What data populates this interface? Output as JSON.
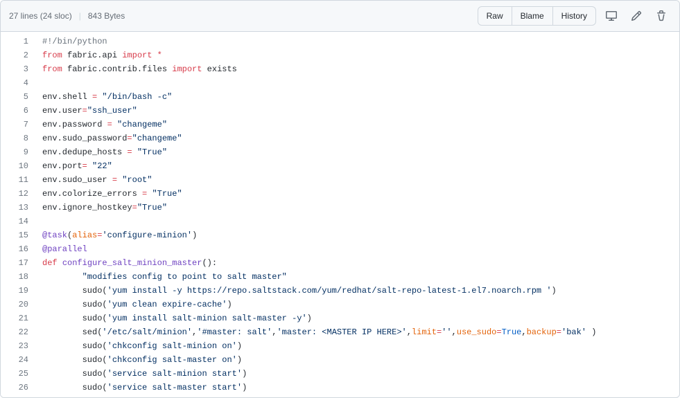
{
  "header": {
    "lines_text": "27 lines (24 sloc)",
    "size_text": "843 Bytes",
    "raw_label": "Raw",
    "blame_label": "Blame",
    "history_label": "History"
  },
  "code": {
    "lines": [
      {
        "n": "1",
        "tokens": [
          {
            "t": "#!/bin/python",
            "c": "c-comment"
          }
        ]
      },
      {
        "n": "2",
        "tokens": [
          {
            "t": "from",
            "c": "c-keyword"
          },
          {
            "t": " fabric.api ",
            "c": ""
          },
          {
            "t": "import",
            "c": "c-keyword"
          },
          {
            "t": " ",
            "c": ""
          },
          {
            "t": "*",
            "c": "c-keyword"
          }
        ]
      },
      {
        "n": "3",
        "tokens": [
          {
            "t": "from",
            "c": "c-keyword"
          },
          {
            "t": " fabric.contrib.files ",
            "c": ""
          },
          {
            "t": "import",
            "c": "c-keyword"
          },
          {
            "t": " exists",
            "c": ""
          }
        ]
      },
      {
        "n": "4",
        "tokens": []
      },
      {
        "n": "5",
        "tokens": [
          {
            "t": "env.shell ",
            "c": ""
          },
          {
            "t": "=",
            "c": "c-keyword"
          },
          {
            "t": " ",
            "c": ""
          },
          {
            "t": "\"/bin/bash -c\"",
            "c": "c-string"
          }
        ]
      },
      {
        "n": "6",
        "tokens": [
          {
            "t": "env.user",
            "c": ""
          },
          {
            "t": "=",
            "c": "c-keyword"
          },
          {
            "t": "\"ssh_user\"",
            "c": "c-string"
          }
        ]
      },
      {
        "n": "7",
        "tokens": [
          {
            "t": "env.password ",
            "c": ""
          },
          {
            "t": "=",
            "c": "c-keyword"
          },
          {
            "t": " ",
            "c": ""
          },
          {
            "t": "\"changeme\"",
            "c": "c-string"
          }
        ]
      },
      {
        "n": "8",
        "tokens": [
          {
            "t": "env.sudo_password",
            "c": ""
          },
          {
            "t": "=",
            "c": "c-keyword"
          },
          {
            "t": "\"changeme\"",
            "c": "c-string"
          }
        ]
      },
      {
        "n": "9",
        "tokens": [
          {
            "t": "env.dedupe_hosts ",
            "c": ""
          },
          {
            "t": "=",
            "c": "c-keyword"
          },
          {
            "t": " ",
            "c": ""
          },
          {
            "t": "\"True\"",
            "c": "c-string"
          }
        ]
      },
      {
        "n": "10",
        "tokens": [
          {
            "t": "env.port",
            "c": ""
          },
          {
            "t": "=",
            "c": "c-keyword"
          },
          {
            "t": " ",
            "c": ""
          },
          {
            "t": "\"22\"",
            "c": "c-string"
          }
        ]
      },
      {
        "n": "11",
        "tokens": [
          {
            "t": "env.sudo_user ",
            "c": ""
          },
          {
            "t": "=",
            "c": "c-keyword"
          },
          {
            "t": " ",
            "c": ""
          },
          {
            "t": "\"root\"",
            "c": "c-string"
          }
        ]
      },
      {
        "n": "12",
        "tokens": [
          {
            "t": "env.colorize_errors ",
            "c": ""
          },
          {
            "t": "=",
            "c": "c-keyword"
          },
          {
            "t": " ",
            "c": ""
          },
          {
            "t": "\"True\"",
            "c": "c-string"
          }
        ]
      },
      {
        "n": "13",
        "tokens": [
          {
            "t": "env.ignore_hostkey",
            "c": ""
          },
          {
            "t": "=",
            "c": "c-keyword"
          },
          {
            "t": "\"True\"",
            "c": "c-string"
          }
        ]
      },
      {
        "n": "14",
        "tokens": []
      },
      {
        "n": "15",
        "tokens": [
          {
            "t": "@task",
            "c": "c-decorator"
          },
          {
            "t": "(",
            "c": ""
          },
          {
            "t": "alias",
            "c": "c-kwarg"
          },
          {
            "t": "=",
            "c": "c-keyword"
          },
          {
            "t": "'configure-minion'",
            "c": "c-string"
          },
          {
            "t": ")",
            "c": ""
          }
        ]
      },
      {
        "n": "16",
        "tokens": [
          {
            "t": "@parallel",
            "c": "c-decorator"
          }
        ]
      },
      {
        "n": "17",
        "tokens": [
          {
            "t": "def",
            "c": "c-keyword"
          },
          {
            "t": " ",
            "c": ""
          },
          {
            "t": "configure_salt_minion_master",
            "c": "c-funcdef"
          },
          {
            "t": "():",
            "c": ""
          }
        ]
      },
      {
        "n": "18",
        "tokens": [
          {
            "t": "        ",
            "c": ""
          },
          {
            "t": "\"modifies config to point to salt master\"",
            "c": "c-string"
          }
        ]
      },
      {
        "n": "19",
        "tokens": [
          {
            "t": "        sudo(",
            "c": ""
          },
          {
            "t": "'yum install -y https://repo.saltstack.com/yum/redhat/salt-repo-latest-1.el7.noarch.rpm '",
            "c": "c-string"
          },
          {
            "t": ")",
            "c": ""
          }
        ]
      },
      {
        "n": "20",
        "tokens": [
          {
            "t": "        sudo(",
            "c": ""
          },
          {
            "t": "'yum clean expire-cache'",
            "c": "c-string"
          },
          {
            "t": ")",
            "c": ""
          }
        ]
      },
      {
        "n": "21",
        "tokens": [
          {
            "t": "        sudo(",
            "c": ""
          },
          {
            "t": "'yum install salt-minion salt-master -y'",
            "c": "c-string"
          },
          {
            "t": ")",
            "c": ""
          }
        ]
      },
      {
        "n": "22",
        "tokens": [
          {
            "t": "        sed(",
            "c": ""
          },
          {
            "t": "'/etc/salt/minion'",
            "c": "c-string"
          },
          {
            "t": ",",
            "c": ""
          },
          {
            "t": "'#master: salt'",
            "c": "c-string"
          },
          {
            "t": ",",
            "c": ""
          },
          {
            "t": "'master: <MASTER IP HERE>'",
            "c": "c-string"
          },
          {
            "t": ",",
            "c": ""
          },
          {
            "t": "limit",
            "c": "c-kwarg"
          },
          {
            "t": "=",
            "c": "c-keyword"
          },
          {
            "t": "''",
            "c": "c-string"
          },
          {
            "t": ",",
            "c": ""
          },
          {
            "t": "use_sudo",
            "c": "c-kwarg"
          },
          {
            "t": "=",
            "c": "c-keyword"
          },
          {
            "t": "True",
            "c": "c-const"
          },
          {
            "t": ",",
            "c": ""
          },
          {
            "t": "backup",
            "c": "c-kwarg"
          },
          {
            "t": "=",
            "c": "c-keyword"
          },
          {
            "t": "'bak'",
            "c": "c-string"
          },
          {
            "t": " )",
            "c": ""
          }
        ]
      },
      {
        "n": "23",
        "tokens": [
          {
            "t": "        sudo(",
            "c": ""
          },
          {
            "t": "'chkconfig salt-minion on'",
            "c": "c-string"
          },
          {
            "t": ")",
            "c": ""
          }
        ]
      },
      {
        "n": "24",
        "tokens": [
          {
            "t": "        sudo(",
            "c": ""
          },
          {
            "t": "'chkconfig salt-master on'",
            "c": "c-string"
          },
          {
            "t": ")",
            "c": ""
          }
        ]
      },
      {
        "n": "25",
        "tokens": [
          {
            "t": "        sudo(",
            "c": ""
          },
          {
            "t": "'service salt-minion start'",
            "c": "c-string"
          },
          {
            "t": ")",
            "c": ""
          }
        ]
      },
      {
        "n": "26",
        "tokens": [
          {
            "t": "        sudo(",
            "c": ""
          },
          {
            "t": "'service salt-master start'",
            "c": "c-string"
          },
          {
            "t": ")",
            "c": ""
          }
        ]
      }
    ]
  }
}
